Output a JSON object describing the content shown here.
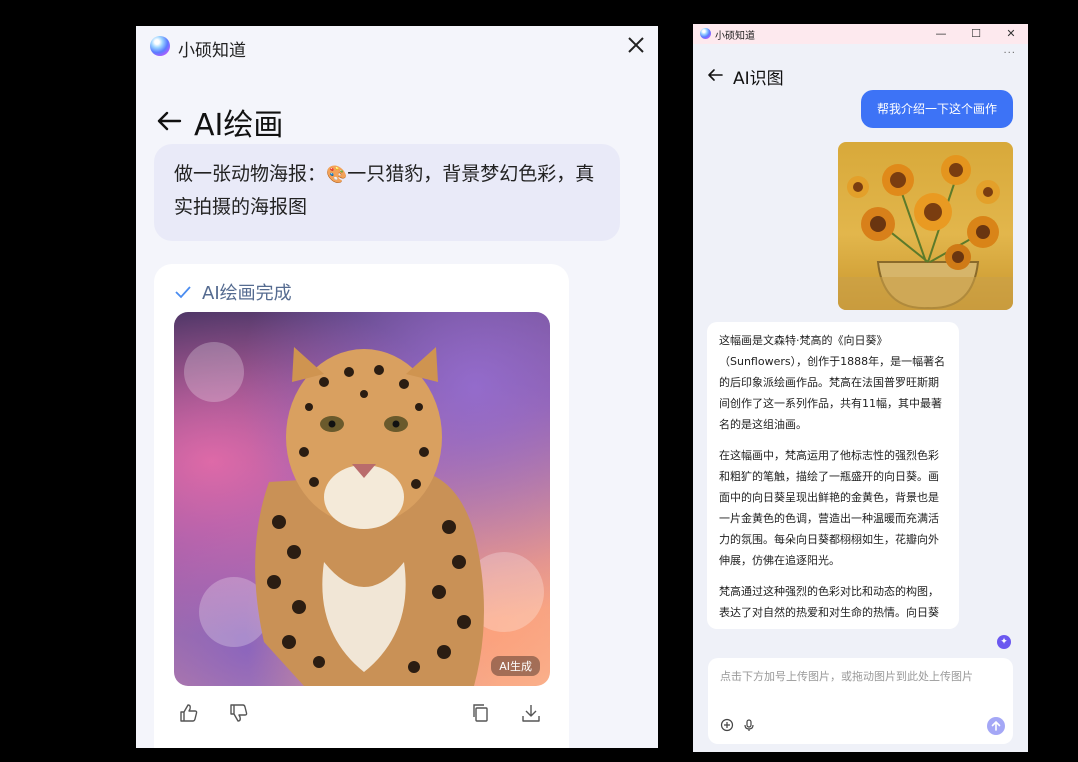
{
  "left_panel": {
    "app_title": "小硕知道",
    "page_title": "AI绘画",
    "prompt": {
      "text_before_icon": "做一张动物海报：",
      "palette_icon": "🎨",
      "text_after_icon": "一只猎豹，背景梦幻色彩，真实拍摄的海报图"
    },
    "result": {
      "status": "AI绘画完成",
      "badge": "AI生成",
      "image": "leopard-painting"
    },
    "actions": [
      "thumbs-up-icon",
      "thumbs-down-icon",
      "copy-icon",
      "download-icon"
    ]
  },
  "right_window": {
    "app_title": "小硕知道",
    "window_controls": {
      "minimize": "—",
      "maximize": "☐",
      "close": "✕"
    },
    "more": "···",
    "page_title": "AI识图",
    "user_message": "帮我介绍一下这个画作",
    "user_image": "sunflowers-painting",
    "answer_paragraphs": [
      "这幅画是文森特·梵高的《向日葵》（Sunflowers），创作于1888年，是一幅著名的后印象派绘画作品。梵高在法国普罗旺斯期间创作了这一系列作品，共有11幅，其中最著名的是这组油画。",
      "在这幅画中，梵高运用了他标志性的强烈色彩和粗犷的笔触，描绘了一瓶盛开的向日葵。画面中的向日葵呈现出鲜艳的金黄色，背景也是一片金黄色的色调，营造出一种温暖而充满活力的氛围。每朵向日葵都栩栩如生，花瓣向外伸展，仿佛在追逐阳光。",
      "梵高通过这种强烈的色彩对比和动态的构图，表达了对自然的热爱和对生命的热情。向日葵"
    ],
    "input_placeholder": "点击下方加号上传图片，或拖动图片到此处上传图片"
  }
}
